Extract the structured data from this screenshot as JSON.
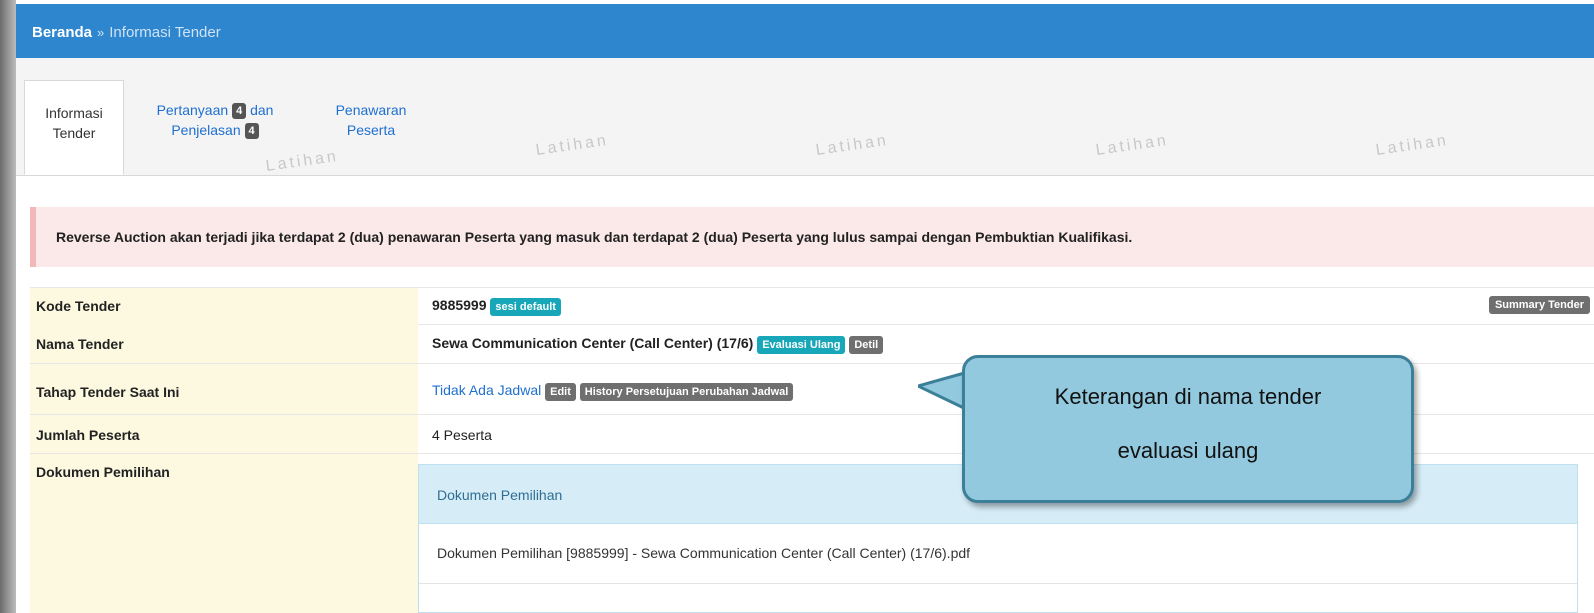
{
  "breadcrumb": {
    "home": "Beranda",
    "separator": "»",
    "current": "Informasi Tender"
  },
  "tabs": {
    "info": {
      "line1": "Informasi",
      "line2": "Tender"
    },
    "questions": {
      "line1_a": "Pertanyaan",
      "badge1": "4",
      "line1_b": "dan",
      "line2_a": "Penjelasan",
      "badge2": "4"
    },
    "offers": {
      "line1": "Penawaran",
      "line2": "Peserta"
    }
  },
  "watermark_text": "Latihan",
  "alert_text": "Reverse Auction akan terjadi jika terdapat 2 (dua) penawaran Peserta yang masuk dan terdapat 2 (dua) Peserta yang lulus sampai dengan Pembuktian Kualifikasi.",
  "rows": {
    "kode": {
      "label": "Kode Tender",
      "value": "9885999",
      "badge": "sesi default",
      "button": "Summary Tender"
    },
    "nama": {
      "label": "Nama Tender",
      "value": "Sewa Communication Center (Call Center) (17/6)",
      "badge_eval": "Evaluasi Ulang",
      "badge_detil": "Detil"
    },
    "tahap": {
      "label": "Tahap Tender Saat Ini",
      "link": "Tidak Ada Jadwal",
      "edit": "Edit",
      "history": "History Persetujuan Perubahan Jadwal"
    },
    "jumlah": {
      "label": "Jumlah Peserta",
      "value": "4 Peserta"
    },
    "dokumen": {
      "label": "Dokumen Pemilihan"
    }
  },
  "doc_panel": {
    "title": "Dokumen Pemilihan",
    "file": "Dokumen Pemilihan [9885999] - Sewa Communication Center (Call Center) (17/6).pdf"
  },
  "callout": {
    "line1": "Keterangan di nama tender",
    "line2": "evaluasi ulang"
  },
  "colors": {
    "topbar": "#2e86cf",
    "teal_badge": "#18a7b8",
    "label_bg": "#fcf9e0",
    "callout_bg": "#92c9de",
    "alert_bg": "#fbe8e8"
  }
}
